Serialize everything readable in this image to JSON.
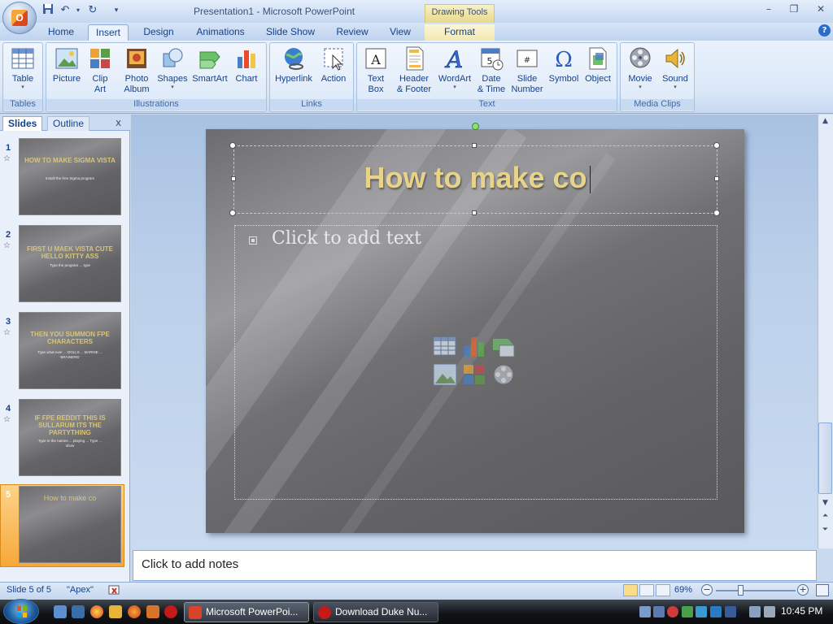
{
  "titlebar": {
    "title": "Presentation1 - Microsoft PowerPoint",
    "contextual_tab": "Drawing Tools",
    "office_logo_letter": "O"
  },
  "tabs": {
    "home": "Home",
    "insert": "Insert",
    "design": "Design",
    "animations": "Animations",
    "slideshow": "Slide Show",
    "review": "Review",
    "view": "View",
    "format": "Format",
    "active": "Insert"
  },
  "ribbon": {
    "groups": {
      "tables": "Tables",
      "illustrations": "Illustrations",
      "links": "Links",
      "text": "Text",
      "media": "Media Clips"
    },
    "buttons": {
      "table": "Table",
      "picture": "Picture",
      "clip_art_1": "Clip",
      "clip_art_2": "Art",
      "photo_album_1": "Photo",
      "photo_album_2": "Album",
      "shapes": "Shapes",
      "smartart": "SmartArt",
      "chart": "Chart",
      "hyperlink": "Hyperlink",
      "action": "Action",
      "text_box_1": "Text",
      "text_box_2": "Box",
      "header_footer_1": "Header",
      "header_footer_2": "& Footer",
      "wordart": "WordArt",
      "date_time_1": "Date",
      "date_time_2": "& Time",
      "slide_number_1": "Slide",
      "slide_number_2": "Number",
      "symbol": "Symbol",
      "object": "Object",
      "movie": "Movie",
      "sound": "Sound"
    }
  },
  "pane": {
    "tab_slides": "Slides",
    "tab_outline": "Outline",
    "close_glyph": "x",
    "thumbnails": [
      {
        "num": "1",
        "title": "HOW TO MAKE SIGMA VISTA",
        "sub": "Install the free Sigma program"
      },
      {
        "num": "2",
        "title": "FIRST U MAEK VISTA CUTE HELLO KITTY ASS",
        "sub": "Type the program ... type"
      },
      {
        "num": "3",
        "title": "THEN YOU SUMMON FPE CHARACTERS",
        "sub": "Type what ever ... DOLLS ... BARNIE ... BRAINERD"
      },
      {
        "num": "4",
        "title": "IF FPE REDDIT THIS IS SULLARUM ITS THE PARTYTHING",
        "sub": "Type in the names ... playing ... Type ... show"
      },
      {
        "num": "5",
        "title": "How to make co",
        "sub": ""
      }
    ]
  },
  "slide": {
    "title": "How to make co",
    "body_placeholder": "Click to add text"
  },
  "notes": {
    "placeholder": "Click to add notes"
  },
  "status": {
    "slide_info": "Slide 5 of 5",
    "theme": "\"Apex\"",
    "zoom": "69%",
    "zoom_minus": "−",
    "zoom_plus": "+"
  },
  "taskbar": {
    "task_powerpoint": "Microsoft PowerPoi...",
    "task_download": "Download Duke Nu...",
    "clock": "10:45 PM"
  },
  "colors": {
    "slide_title": "#e7d48a",
    "ribbon_text": "#15428b",
    "selected_thumb": "#f6a83a"
  }
}
